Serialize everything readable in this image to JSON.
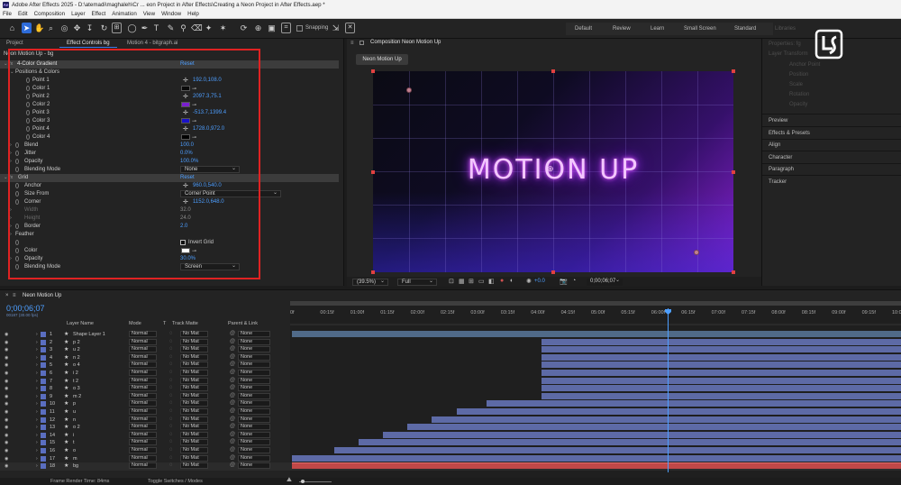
{
  "window": {
    "title": "Adobe After Effects 2025 - D:\\atemadi\\maghaleh\\Cr ... eon Project in After Effects\\Creating a Neon Project in After Effects.aep *"
  },
  "menu": [
    "File",
    "Edit",
    "Composition",
    "Layer",
    "Effect",
    "Animation",
    "View",
    "Window",
    "Help"
  ],
  "toolbar": {
    "snapping": "Snapping"
  },
  "workspaces": [
    "Default",
    "Review",
    "Learn",
    "Small Screen",
    "Standard",
    "Libraries"
  ],
  "left_panel": {
    "tabs": [
      "Project",
      "Effect Controls bg",
      "Motion 4 - bitgraph.ai"
    ],
    "header": "Neon Motion Up - bg",
    "effects": [
      {
        "name": "4-Color Gradient",
        "reset": "Reset"
      },
      {
        "name": "Positions & Colors"
      },
      {
        "name": "Point 1",
        "value": "192.0,108.0"
      },
      {
        "name": "Color 1"
      },
      {
        "name": "Point 2",
        "value": "2097.3,75.1"
      },
      {
        "name": "Color 2"
      },
      {
        "name": "Point 3",
        "value": "-513.7,1399.4"
      },
      {
        "name": "Color 3"
      },
      {
        "name": "Point 4",
        "value": "1728.0,972.0"
      },
      {
        "name": "Color 4"
      },
      {
        "name": "Blend",
        "value": "100.0"
      },
      {
        "name": "Jitter",
        "value": "0.0%"
      },
      {
        "name": "Opacity",
        "value": "100.0%"
      },
      {
        "name": "Blending Mode",
        "value": "None"
      },
      {
        "name": "Grid",
        "reset": "Reset"
      },
      {
        "name": "Anchor",
        "value": "960.0,540.0"
      },
      {
        "name": "Size From",
        "value": "Corner Point"
      },
      {
        "name": "Corner",
        "value": "1152.0,648.0"
      },
      {
        "name": "Width",
        "value": "32.0"
      },
      {
        "name": "Height",
        "value": "24.0"
      },
      {
        "name": "Border",
        "value": "2.0"
      },
      {
        "name": "Feather"
      },
      {
        "name": "Invert Grid"
      },
      {
        "name": "Color"
      },
      {
        "name": "Opacity",
        "value": "30.0%"
      },
      {
        "name": "Blending Mode",
        "value": "Screen"
      }
    ],
    "colors": {
      "color1": "#0a0a0a",
      "color2": "#7a1fd0",
      "color3": "#1a12c8",
      "color4": "#000000",
      "grid_color": "#ffffff"
    }
  },
  "composition": {
    "tab": "Composition Neon Motion Up",
    "sub_tab": "Neon Motion Up",
    "text": "MOTION UP",
    "viewbar": {
      "zoom": "(39.5%)",
      "resolution": "Full",
      "exposure": "+0.0",
      "timecode": "0;00;06;07"
    }
  },
  "right_panel": {
    "properties": "Properties: fg",
    "layer_transform": "Layer Transform",
    "items": [
      "Anchor Point",
      "Position",
      "Scale",
      "Rotation",
      "Opacity"
    ],
    "sections": [
      "Preview",
      "Effects & Presets",
      "Align",
      "Character",
      "Paragraph",
      "Tracker"
    ]
  },
  "timeline": {
    "comp_tab": "Neon Motion Up",
    "timecode": "0;00;06;07",
    "fps": "00187 (30.00 fps)",
    "headers": {
      "layer_name": "Layer Name",
      "mode": "Mode",
      "t": "T",
      "track_matte": "Track Matte",
      "parent": "Parent & Link"
    },
    "ticks": [
      "0f",
      "00:15f",
      "01:00f",
      "01:15f",
      "02:00f",
      "02:15f",
      "03:00f",
      "03:15f",
      "04:00f",
      "04:15f",
      "05:00f",
      "05:15f",
      "06:00f",
      "06:15f",
      "07:00f",
      "07:15f",
      "08:00f",
      "08:15f",
      "09:00f",
      "09:15f",
      "10:0"
    ],
    "layers": [
      {
        "num": "1",
        "name": "Shape Layer 1",
        "mode": "Normal",
        "matte": "No Mat",
        "parent": "None",
        "start": 0.0
      },
      {
        "num": "2",
        "name": "p 2",
        "mode": "Normal",
        "matte": "No Mat",
        "parent": "None",
        "start": 0.41
      },
      {
        "num": "3",
        "name": "u 2",
        "mode": "Normal",
        "matte": "No Mat",
        "parent": "None",
        "start": 0.41
      },
      {
        "num": "4",
        "name": "n 2",
        "mode": "Normal",
        "matte": "No Mat",
        "parent": "None",
        "start": 0.41
      },
      {
        "num": "5",
        "name": "o 4",
        "mode": "Normal",
        "matte": "No Mat",
        "parent": "None",
        "start": 0.41
      },
      {
        "num": "6",
        "name": "i 2",
        "mode": "Normal",
        "matte": "No Mat",
        "parent": "None",
        "start": 0.41
      },
      {
        "num": "7",
        "name": "t 2",
        "mode": "Normal",
        "matte": "No Mat",
        "parent": "None",
        "start": 0.41
      },
      {
        "num": "8",
        "name": "o 3",
        "mode": "Normal",
        "matte": "No Mat",
        "parent": "None",
        "start": 0.41
      },
      {
        "num": "9",
        "name": "m 2",
        "mode": "Normal",
        "matte": "No Mat",
        "parent": "None",
        "start": 0.41
      },
      {
        "num": "10",
        "name": "p",
        "mode": "Normal",
        "matte": "No Mat",
        "parent": "None",
        "start": 0.32
      },
      {
        "num": "11",
        "name": "u",
        "mode": "Normal",
        "matte": "No Mat",
        "parent": "None",
        "start": 0.27
      },
      {
        "num": "12",
        "name": "n",
        "mode": "Normal",
        "matte": "No Mat",
        "parent": "None",
        "start": 0.23
      },
      {
        "num": "13",
        "name": "o 2",
        "mode": "Normal",
        "matte": "No Mat",
        "parent": "None",
        "start": 0.19
      },
      {
        "num": "14",
        "name": "i",
        "mode": "Normal",
        "matte": "No Mat",
        "parent": "None",
        "start": 0.15
      },
      {
        "num": "15",
        "name": "t",
        "mode": "Normal",
        "matte": "No Mat",
        "parent": "None",
        "start": 0.11
      },
      {
        "num": "16",
        "name": "o",
        "mode": "Normal",
        "matte": "No Mat",
        "parent": "None",
        "start": 0.07
      },
      {
        "num": "17",
        "name": "m",
        "mode": "Normal",
        "matte": "No Mat",
        "parent": "None",
        "start": 0.0
      },
      {
        "num": "18",
        "name": "bg",
        "mode": "Normal",
        "matte": "No Mat",
        "parent": "None",
        "start": 0.0
      }
    ],
    "footer": {
      "render_time": "Frame Render Time: 84ms",
      "toggle": "Toggle Switches / Modes"
    }
  },
  "accent": "#2d6bd8",
  "highlight": "#e02222"
}
